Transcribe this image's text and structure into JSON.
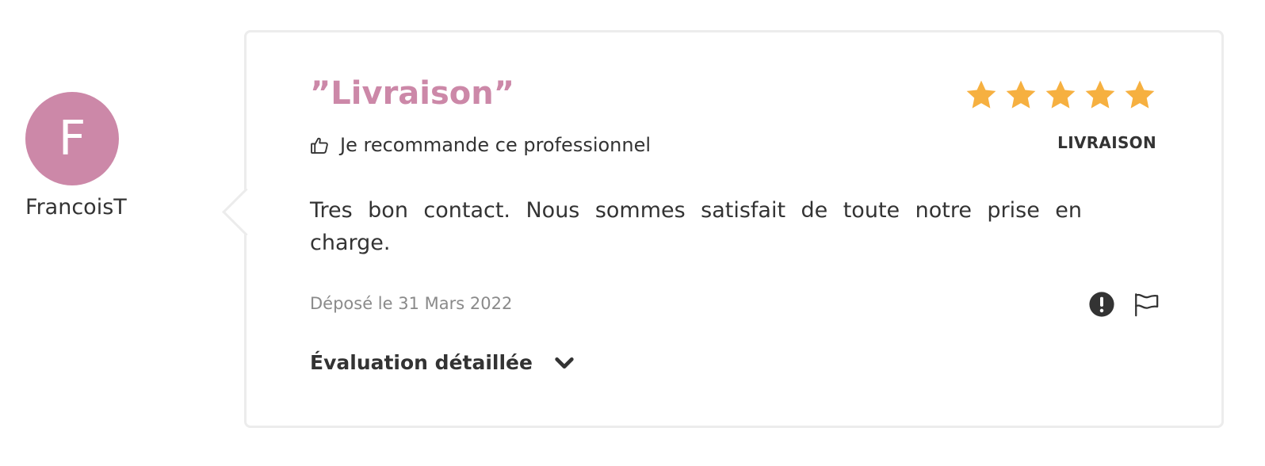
{
  "author": {
    "initial": "F",
    "name": "FrancoisT"
  },
  "review": {
    "title": "”Livraison”",
    "recommend_text": "Je recommande ce professionnel",
    "rating": 5,
    "rating_max": 5,
    "category": "LIVRAISON",
    "text": "Tres bon contact. Nous sommes satisfait de toute notre prise en charge.",
    "date": "Déposé le 31 Mars 2022",
    "details_label": "Évaluation détaillée"
  },
  "colors": {
    "accent": "#cc88a8",
    "star": "#f6b040",
    "text": "#333333",
    "muted": "#8a8a8a",
    "border": "#ececec"
  },
  "icons": {
    "recommend": "thumbs-up-icon",
    "star": "star-icon",
    "alert": "exclamation-circle-icon",
    "report": "flag-icon",
    "expand": "chevron-down-icon"
  }
}
